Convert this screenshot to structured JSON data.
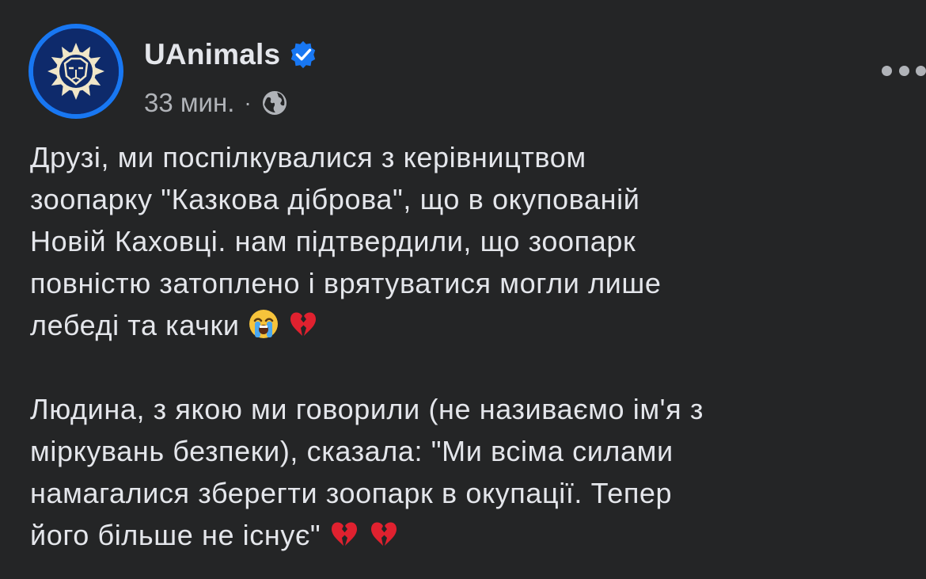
{
  "post": {
    "author": "UAnimals",
    "verified": true,
    "time": "33 мин.",
    "separator": "·",
    "audience_icon": "globe-icon",
    "more_icon": "more-options-icon",
    "paragraph1": {
      "line1": "Друзі, ми поспілкувалися з керівництвом",
      "line2": "зоопарку \"Казкова діброва\", що в окупованій",
      "line3": "Новій Каховці. нам підтвердили, що зоопарк",
      "line4": "повністю затоплено і врятуватися могли лише",
      "line5": "лебеді та качки",
      "emojis": [
        "loudly-crying-face",
        "broken-heart"
      ]
    },
    "paragraph2": {
      "line1": "Людина, з якою ми говорили (не називаємо ім'я з",
      "line2": "міркувань безпеки), сказала: \"Ми всіма силами",
      "line3": "намагалися зберегти зоопарк в окупації. Тепер",
      "line4": "його більше не існує\"",
      "emojis": [
        "broken-heart",
        "broken-heart"
      ]
    }
  },
  "colors": {
    "background": "#242526",
    "text_primary": "#e4e6eb",
    "text_secondary": "#b0b3b8",
    "verified_badge": "#1877f2",
    "avatar_ring": "#1877f2",
    "avatar_bg": "#0e2a6b"
  }
}
